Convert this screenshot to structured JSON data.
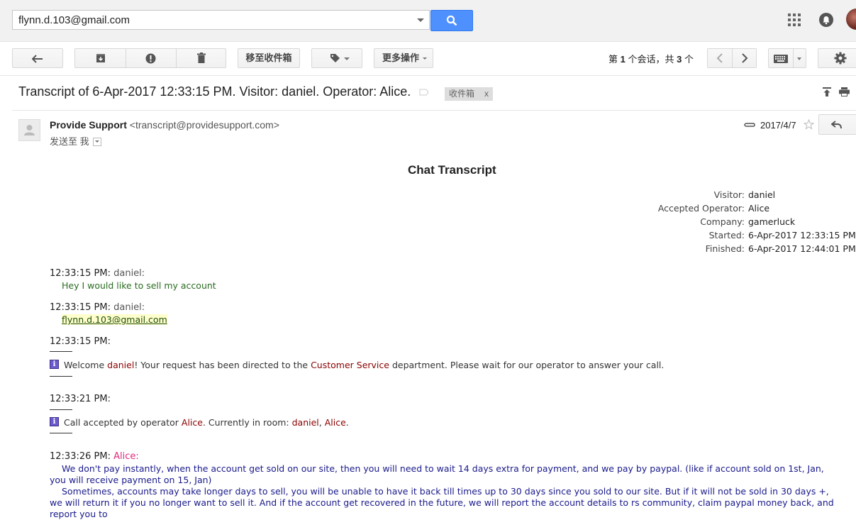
{
  "search": {
    "value": "flynn.d.103@gmail.com"
  },
  "toolbar": {
    "move_to_inbox": "移至收件箱",
    "more_actions": "更多操作",
    "count_prefix": "第 ",
    "count_current": "1",
    "count_middle": " 个会话，共 ",
    "count_total": "3",
    "count_suffix": " 个"
  },
  "subject": "Transcript of 6-Apr-2017 12:33:15 PM. Visitor: daniel. Operator: Alice.",
  "label_tag": {
    "name": "收件箱",
    "remove": "x"
  },
  "message": {
    "sender_name": "Provide Support",
    "sender_email": "<transcript@providesupport.com>",
    "to_prefix": "发送至",
    "to_me": "我",
    "date": "2017/4/7"
  },
  "transcript": {
    "title": "Chat Transcript",
    "info": [
      {
        "label": "Visitor:",
        "value": "daniel"
      },
      {
        "label": "Accepted Operator:",
        "value": "Alice"
      },
      {
        "label": "Company:",
        "value": "gamerluck"
      },
      {
        "label": "Started:",
        "value": "6-Apr-2017 12:33:15 PM"
      },
      {
        "label": "Finished:",
        "value": "6-Apr-2017 12:44:01 PM"
      }
    ],
    "entries": [
      {
        "time": "12:33:15 PM:",
        "who": "daniel:",
        "text": "Hey I would like to sell my account"
      },
      {
        "time": "12:33:15 PM:",
        "who": "daniel:",
        "text": "flynn.d.103@gmail.com"
      },
      {
        "time": "12:33:15 PM:",
        "sys": {
          "a": "Welcome ",
          "b": "daniel",
          "c": "! Your request has been directed to the ",
          "d": "Customer Service",
          "e": " department. Please wait for our operator to answer your call."
        }
      },
      {
        "time": "12:33:21 PM:",
        "sys": {
          "a": "Call accepted by operator ",
          "b": "Alice",
          "c": ". Currently in room: ",
          "d": "daniel",
          "e": ", ",
          "f": "Alice",
          "g": "."
        }
      },
      {
        "time": "12:33:26 PM:",
        "who": "Alice:",
        "p1": "We don't pay instantly, when the account get sold on our site, then you will need to wait 14 days extra for payment, and we pay by paypal. (like if account sold on 1st, Jan, you will receive payment on 15, Jan)",
        "p2": "Sometimes, accounts may take longer days to sell, you will be unable to have it back till times up to 30 days since you sold to our site. But if it will not be sold in 30 days +, we will return it if you no longer want to sell it. And if the account get recovered in the future, we will report the account details to rs community, claim paypal money back, and report you to"
      }
    ]
  }
}
